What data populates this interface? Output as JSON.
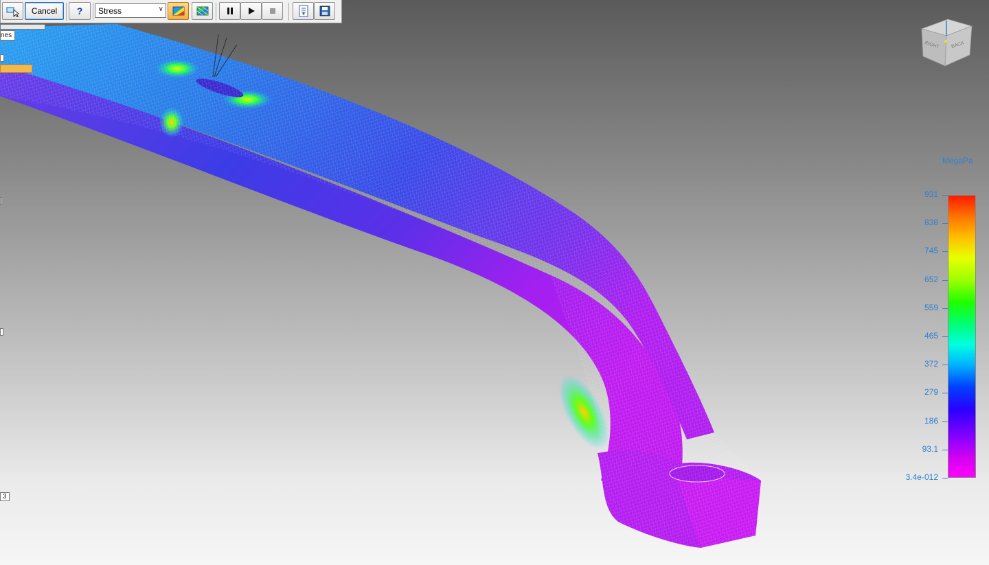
{
  "toolbar": {
    "cancel_label": "Cancel",
    "help_label": "?",
    "result_type": "Stress"
  },
  "left_panel": {
    "tab_label": "nes",
    "page_label": "3"
  },
  "legend": {
    "unit": "MegaPa",
    "levels": [
      "931",
      "838",
      "745",
      "652",
      "559",
      "465",
      "372",
      "279",
      "186",
      "93.1",
      "3.4e-012"
    ],
    "max_color": "#ff1a00",
    "min_color": "#ff00ff"
  },
  "viewcube": {
    "face_left": "RIGHT",
    "face_right": "BACK"
  },
  "colors": {
    "accent": "#2f7fd0",
    "part_low_stress": "#b51cf0",
    "part_mid_stress": "#1f4fe0"
  }
}
